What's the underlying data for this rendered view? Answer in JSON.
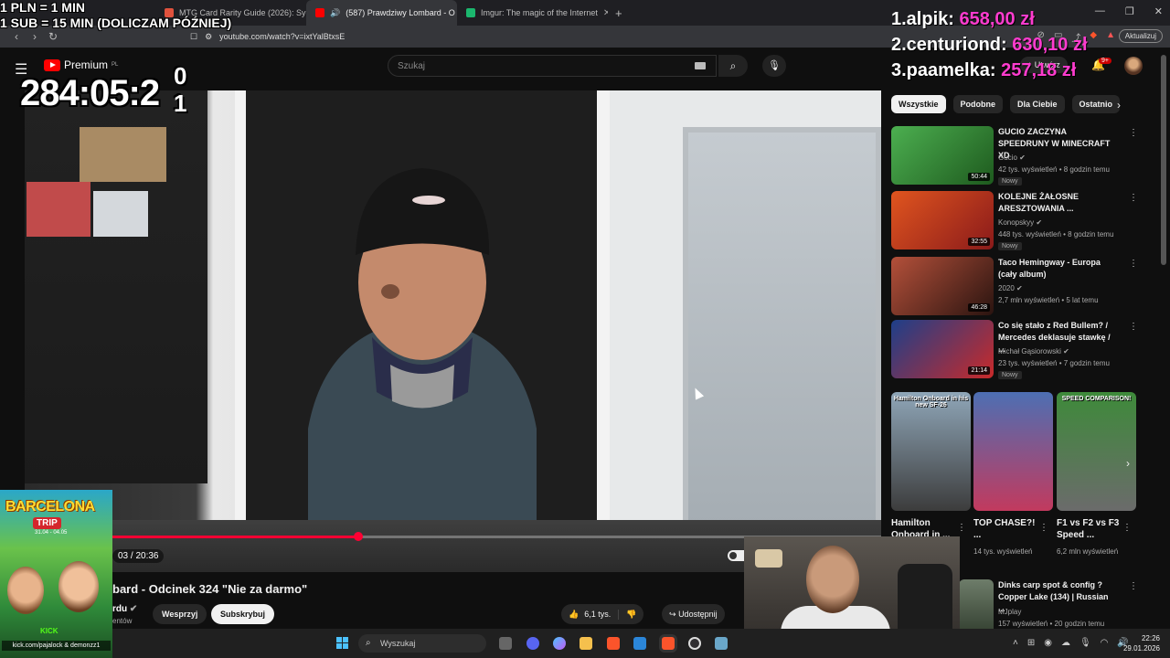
{
  "browser": {
    "tabs": [
      {
        "label": "MTG Card Rarity Guide (2026): Symb",
        "color": "#e0523d"
      },
      {
        "label": "(587) Prawdziwy Lombard - O",
        "color": "#ff0000"
      },
      {
        "label": "Imgur: The magic of the Internet",
        "color": "#1bb76e"
      }
    ],
    "url": "youtube.com/watch?v=ixtYalBtxsE",
    "update_label": "Aktualizuj"
  },
  "youtube": {
    "logo_text": "Premium",
    "logo_region": "PL",
    "search_placeholder": "Szukaj",
    "create_label": "Utwórz",
    "notif_count": "9+",
    "video": {
      "time": "03 / 20:36",
      "progress": 0.32,
      "title": "bard - Odcinek 324 \"Nie za darmo\"",
      "channel": "rdu",
      "channel_sub": "entów",
      "support_label": "Wesprzyj",
      "subscribe_label": "Subskrybuj",
      "likes": "6,1 tys.",
      "share_label": "Udostępnij"
    },
    "chips": [
      "Wszystkie",
      "Podobne",
      "Dla Ciebie",
      "Ostatnio"
    ],
    "recommendations": [
      {
        "title": "GUCIO ZACZYNA SPEEDRUNY W MINECRAFT XD",
        "channel": "Gucio",
        "meta": "42 tys. wyświetleń • 8 godzin temu",
        "badge": "Nowy",
        "duration": "50:44",
        "color1": "#4caf50",
        "color2": "#1e5a1e"
      },
      {
        "title": "KOLEJNE ŻAŁOSNE ARESZTOWANIA ...",
        "channel": "Konopskyy",
        "meta": "448 tys. wyświetleń • 8 godzin temu",
        "badge": "Nowy",
        "duration": "32:55",
        "color1": "#e0551f",
        "color2": "#8a1a1a"
      },
      {
        "title": "Taco Hemingway - Europa (cały album)",
        "channel": "2020",
        "meta": "2,7 mln wyświetleń • 5 lat temu",
        "badge": "",
        "duration": "46:28",
        "color1": "#b4503a",
        "color2": "#2a1410"
      },
      {
        "title": "Co się stało z Red Bullem? / Mercedes deklasuje stawkę / ...",
        "channel": "Michał Gąsiorowski",
        "meta": "23 tys. wyświetleń • 7 godzin temu",
        "badge": "Nowy",
        "duration": "21:14",
        "color1": "#1d3f8a",
        "color2": "#c92a2a"
      }
    ],
    "shorts": [
      {
        "title": "Hamilton Onboard in ...",
        "views": "",
        "caption": "Hamilton Onboard in his new SF-26",
        "color1": "#8fa6b8",
        "color2": "#3c3c3c"
      },
      {
        "title": "TOP CHASE?! ...",
        "views": "14 tys. wyświetleń",
        "caption": "",
        "color1": "#4d6fb3",
        "color2": "#c23a5e"
      },
      {
        "title": "F1 vs F2 vs F3 Speed ...",
        "views": "6,2 mln wyświetleń",
        "caption": "SPEED COMPARISON!",
        "color1": "#3e8a3a",
        "color2": "#6b6b6b"
      }
    ],
    "last_rec": {
      "title": "Dinks carp spot & config ? Copper Lake (134) | Russian ...",
      "channel": "MJplay",
      "meta": "157 wyświetleń • 20 godzin temu"
    }
  },
  "overlay": {
    "rules_line1": "1 PLN = 1 MIN",
    "rules_line2": "1 SUB = 15 MIN (DOLICZAM PÓŹNIEJ)",
    "timer": "284:05:2",
    "timer_extra": "0\n1",
    "leaderboard": [
      {
        "name": "1.alpik: ",
        "amount": "658,00 zł"
      },
      {
        "name": "2.centuriond: ",
        "amount": "630,10 zł"
      },
      {
        "name": "3.paamelka: ",
        "amount": "257,18 zł"
      }
    ],
    "promo": {
      "title": "BARCELONA",
      "trip": "TRIP",
      "dates": "31.04 - 04.05",
      "kick": "KICK",
      "links": "kick.com/pajalock & demonzz1"
    }
  },
  "taskbar": {
    "search_placeholder": "Wyszukaj",
    "time": "22:26",
    "date": "29.01.2026"
  }
}
